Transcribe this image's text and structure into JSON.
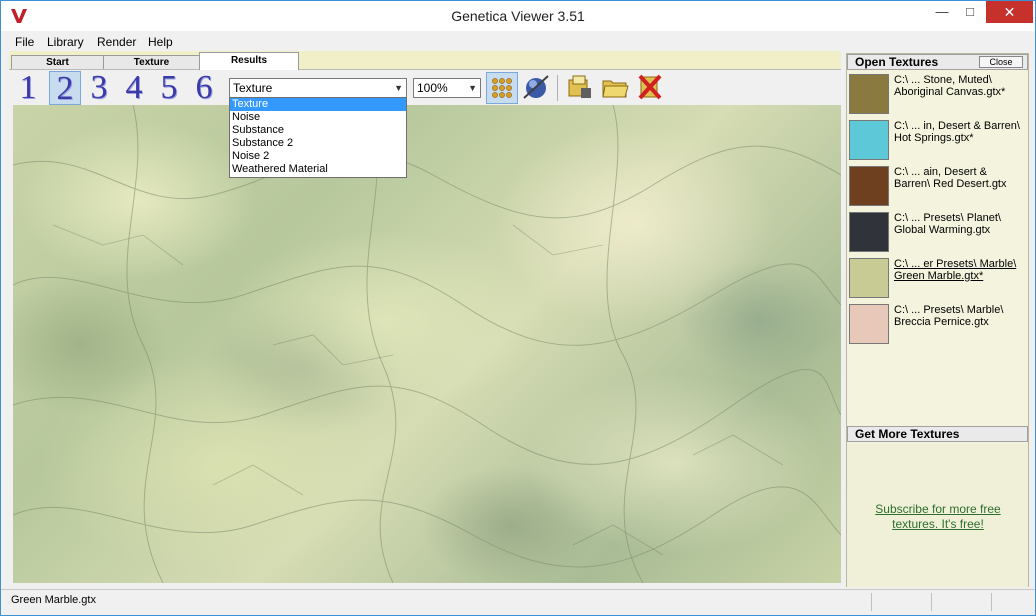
{
  "window": {
    "title": "Genetica Viewer 3.51",
    "minimize": "—",
    "maximize": "□",
    "close": "✕"
  },
  "menu": [
    "File",
    "Library",
    "Render",
    "Help"
  ],
  "tabs": [
    {
      "label": "Start",
      "active": false
    },
    {
      "label": "Texture",
      "active": false
    },
    {
      "label": "Results",
      "active": true
    }
  ],
  "toolbar": {
    "numbers": [
      "1",
      "2",
      "3",
      "4",
      "5",
      "6"
    ],
    "active_number": "2",
    "channel_select": "Texture",
    "zoom_select": "100%",
    "icons": [
      "tile-grid-icon",
      "sphere-preview-icon",
      "save-texture-icon",
      "open-folder-icon",
      "delete-icon"
    ]
  },
  "channel_dropdown": {
    "options": [
      "Texture",
      "Noise",
      "Substance",
      "Substance 2",
      "Noise 2",
      "Weathered Material"
    ],
    "selected": "Texture"
  },
  "open_textures": {
    "header": "Open Textures",
    "close_label": "Close",
    "items": [
      {
        "label": "C:\\ ...  Stone, Muted\\ Aboriginal Canvas.gtx*",
        "swatch": "#8a7a40",
        "active": false
      },
      {
        "label": "C:\\ ... in, Desert & Barren\\ Hot Springs.gtx*",
        "swatch": "#5cc8d8",
        "active": false
      },
      {
        "label": "C:\\ ... ain, Desert & Barren\\ Red Desert.gtx",
        "swatch": "#6e4020",
        "active": false
      },
      {
        "label": "C:\\ ...  Presets\\ Planet\\ Global Warming.gtx",
        "swatch": "#30343a",
        "active": false
      },
      {
        "label": "C:\\ ... er Presets\\ Marble\\ Green Marble.gtx*",
        "swatch": "#c8cc94",
        "active": true
      },
      {
        "label": "C:\\ ...  Presets\\ Marble\\ Breccia Pernice.gtx",
        "swatch": "#e8c8b8",
        "active": false
      }
    ]
  },
  "more_textures": {
    "header": "Get More Textures",
    "link": "Subscribe for more free textures.  It's free!"
  },
  "status": {
    "text": "Green Marble.gtx"
  },
  "colors": {
    "accent_blue": "#3399ff",
    "number_blue": "#3a3aa8",
    "link_green": "#2e6e2e",
    "close_red": "#c7312b"
  }
}
